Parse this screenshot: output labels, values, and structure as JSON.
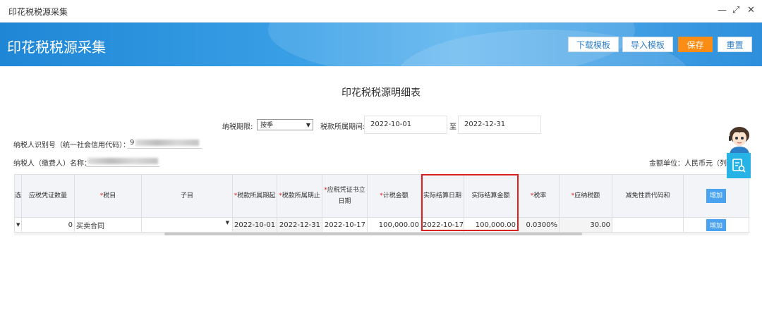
{
  "window": {
    "title": "印花税税源采集",
    "minimize": "—",
    "maximize": "⤢",
    "close": "✕"
  },
  "banner": {
    "title": "印花税税源采集"
  },
  "toolbar": {
    "download": "下载模板",
    "import": "导入模板",
    "save": "保存",
    "reset": "重置"
  },
  "form": {
    "title": "印花税税源明细表",
    "period_label": "纳税期限:",
    "period_value": "按季",
    "range_label": "税款所属期间:",
    "start_date": "2022-10-01",
    "to": "至",
    "end_date": "2022-12-31",
    "taxpayer_id_label": "纳税人识别号（统一社会信用代码）：",
    "taxpayer_id_prefix": "9",
    "taxpayer_name_label": "纳税人（缴费人）名称：",
    "amount_unit": "金额单位：人民币元（列至"
  },
  "table": {
    "required_mark": "*",
    "headers": {
      "c0": "选",
      "count": "应税凭证数量",
      "item": "税目",
      "subitem": "子目",
      "period_start": "税款所属期起",
      "period_end": "税款所属期止",
      "voucher_date": "应税凭证书立日期",
      "tax_amount": "计税金额",
      "settle_date": "实际结算日期",
      "settle_amount": "实际结算金额",
      "rate": "税率",
      "tax_payable": "应纳税额",
      "relief": "减免性质代码和",
      "add": "增加"
    },
    "row": {
      "count": "0",
      "item": "买卖合同",
      "period_start": "2022-10-01",
      "period_end": "2022-12-31",
      "voucher_date": "2022-10-17",
      "tax_amount": "100,000.00",
      "settle_date": "2022-10-17",
      "settle_amount": "100,000.00",
      "rate": "0.0300%",
      "tax_payable": "30.00",
      "add": "增加"
    }
  },
  "colors": {
    "accent": "#2f7fc6",
    "save": "#fb8c14",
    "required": "#e02020",
    "highlight": "#d9221e"
  }
}
